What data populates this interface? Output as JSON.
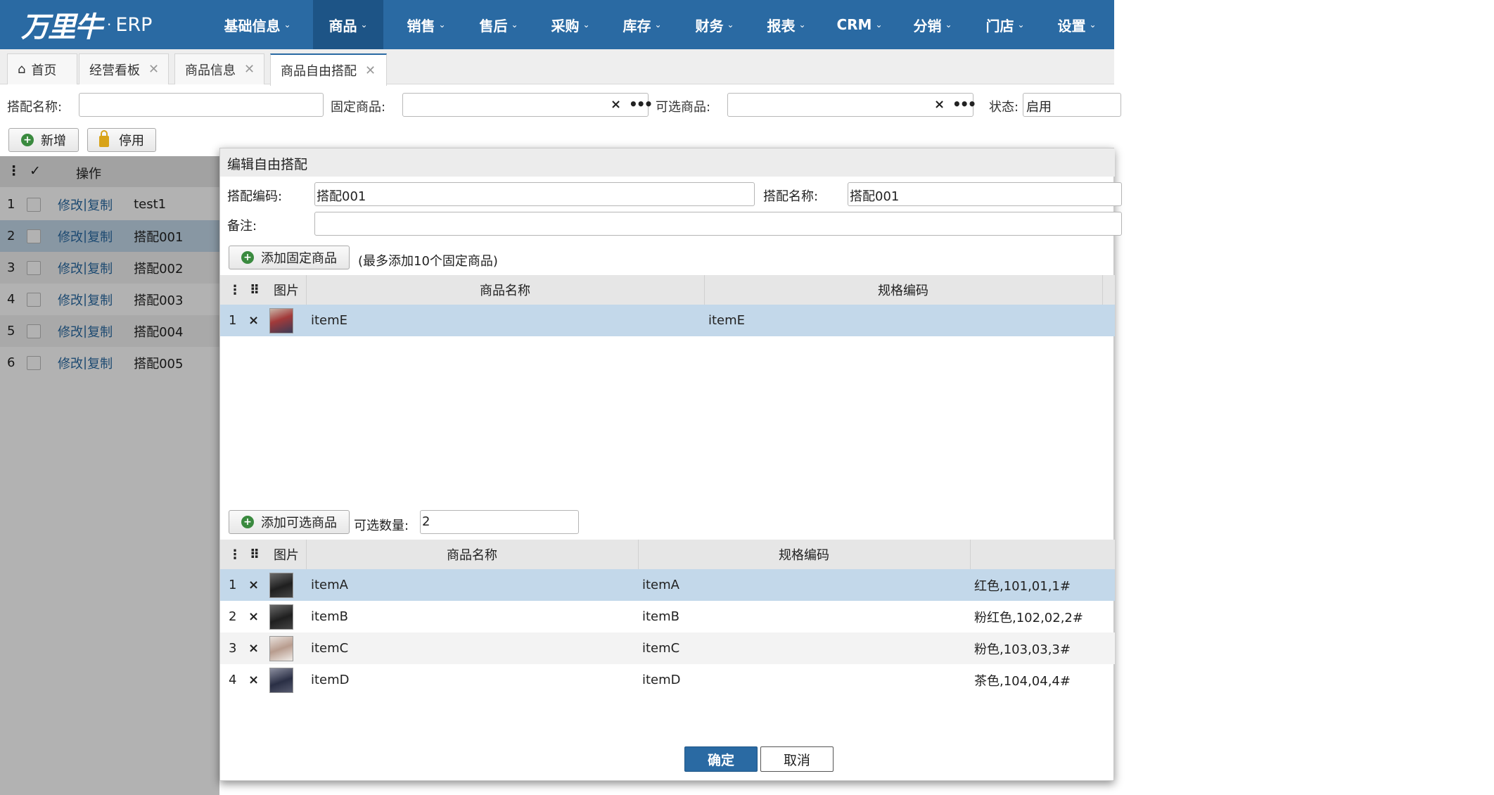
{
  "brand": {
    "logo_text": "万里牛",
    "dot": "·",
    "suffix": "ERP"
  },
  "nav": [
    {
      "label": "基础信息"
    },
    {
      "label": "商品"
    },
    {
      "label": "销售"
    },
    {
      "label": "售后"
    },
    {
      "label": "采购"
    },
    {
      "label": "库存"
    },
    {
      "label": "财务"
    },
    {
      "label": "报表"
    },
    {
      "label": "CRM"
    },
    {
      "label": "分销"
    },
    {
      "label": "门店"
    },
    {
      "label": "设置"
    }
  ],
  "tabs": [
    {
      "label": "首页"
    },
    {
      "label": "经营看板"
    },
    {
      "label": "商品信息"
    },
    {
      "label": "商品自由搭配"
    }
  ],
  "filters": {
    "name_label": "搭配名称:",
    "fixed_label": "固定商品:",
    "optional_label": "可选商品:",
    "status_label": "状态:",
    "status_value": "启用",
    "clear": "×",
    "more": "•••"
  },
  "toolbar": {
    "add": "新增",
    "disable": "停用"
  },
  "list": {
    "header_check": "✓",
    "header_op": "操作",
    "rows": [
      {
        "no": "1",
        "edit": "修改",
        "sep": "|",
        "copy": "复制",
        "name": "test1"
      },
      {
        "no": "2",
        "edit": "修改",
        "sep": "|",
        "copy": "复制",
        "name": "搭配001"
      },
      {
        "no": "3",
        "edit": "修改",
        "sep": "|",
        "copy": "复制",
        "name": "搭配002"
      },
      {
        "no": "4",
        "edit": "修改",
        "sep": "|",
        "copy": "复制",
        "name": "搭配003"
      },
      {
        "no": "5",
        "edit": "修改",
        "sep": "|",
        "copy": "复制",
        "name": "搭配004"
      },
      {
        "no": "6",
        "edit": "修改",
        "sep": "|",
        "copy": "复制",
        "name": "搭配005"
      }
    ]
  },
  "dialog": {
    "title": "编辑自由搭配",
    "code_label": "搭配编码:",
    "code_value": "搭配001",
    "name_label": "搭配名称:",
    "name_value": "搭配001",
    "remark_label": "备注:",
    "remark_value": "",
    "add_fixed": "添加固定商品",
    "fixed_hint": "(最多添加10个固定商品)",
    "col_image": "图片",
    "col_name": "商品名称",
    "col_spec": "规格编码",
    "fixed_rows": [
      {
        "no": "1",
        "del": "×",
        "name": "itemE",
        "spec": "itemE"
      }
    ],
    "add_optional": "添加可选商品",
    "optional_count_label": "可选数量:",
    "optional_count": "2",
    "optional_rows": [
      {
        "no": "1",
        "del": "×",
        "name": "itemA",
        "spec": "itemA",
        "attr": "红色,101,01,1#"
      },
      {
        "no": "2",
        "del": "×",
        "name": "itemB",
        "spec": "itemB",
        "attr": "粉红色,102,02,2#"
      },
      {
        "no": "3",
        "del": "×",
        "name": "itemC",
        "spec": "itemC",
        "attr": "粉色,103,03,3#"
      },
      {
        "no": "4",
        "del": "×",
        "name": "itemD",
        "spec": "itemD",
        "attr": "茶色,104,04,4#"
      }
    ],
    "ok": "确定",
    "cancel": "取消"
  },
  "icons": {
    "home": "home-icon",
    "close": "close-icon",
    "plus": "plus-circle-icon",
    "lock": "lock-icon",
    "chevron": "chevron-down-icon",
    "drag": "drag-handle-icon",
    "menu": "vertical-dots-icon"
  },
  "colors": {
    "brand_blue": "#2a6aa3",
    "nav_active": "#1d5486",
    "selected_row": "#c3d8ea",
    "add_green": "#3a8a3f",
    "lock_yellow": "#d8a318"
  }
}
